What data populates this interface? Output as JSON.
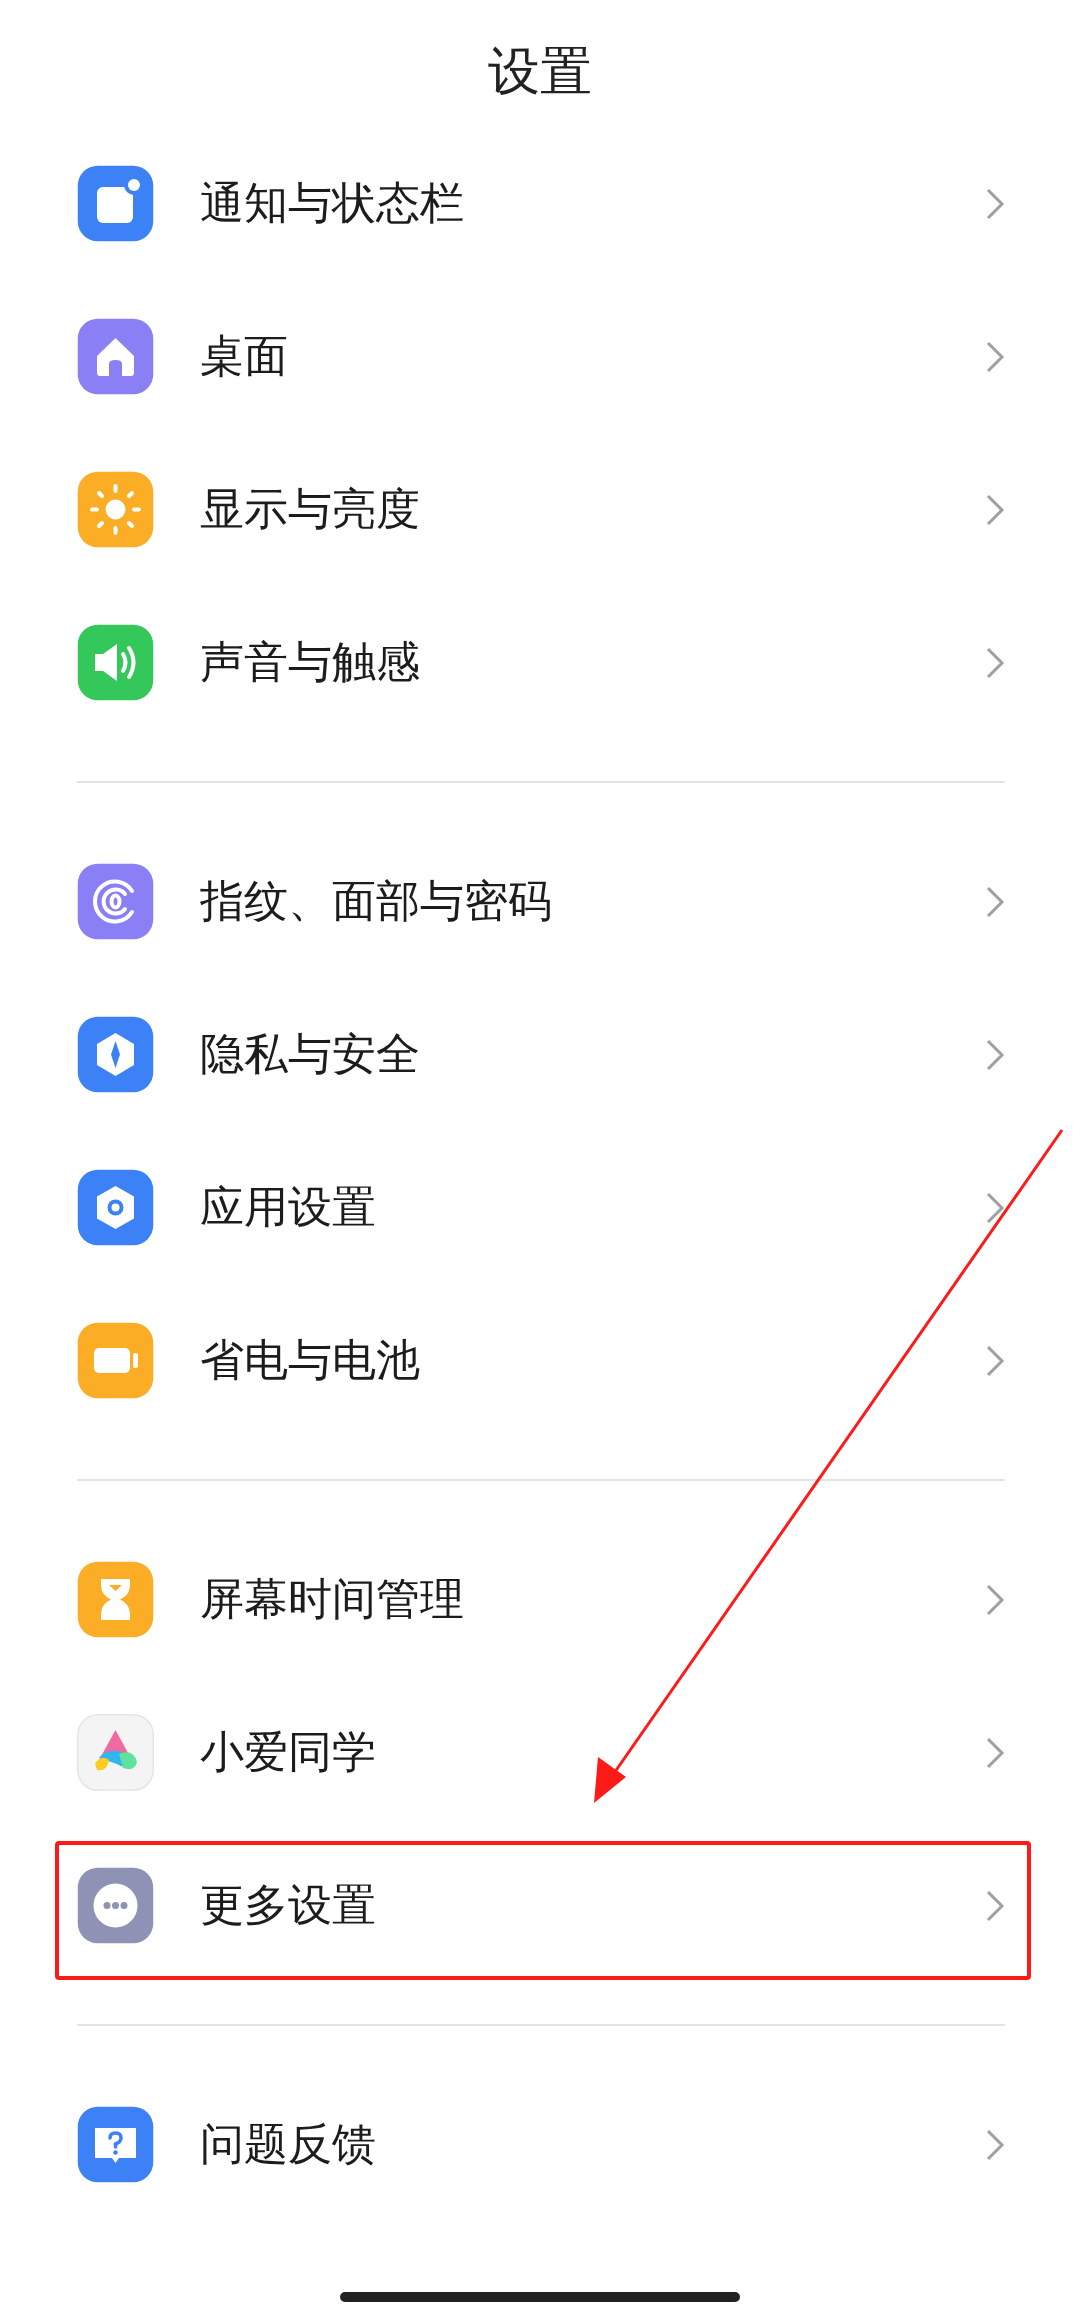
{
  "title": "设置",
  "groups": [
    {
      "items": [
        {
          "label": "通知与状态栏",
          "highlighted": false
        },
        {
          "label": "桌面",
          "highlighted": false
        },
        {
          "label": "显示与亮度",
          "highlighted": false
        },
        {
          "label": "声音与触感",
          "highlighted": false
        }
      ]
    },
    {
      "items": [
        {
          "label": "指纹、面部与密码",
          "highlighted": false
        },
        {
          "label": "隐私与安全",
          "highlighted": false
        },
        {
          "label": "应用设置",
          "highlighted": false
        },
        {
          "label": "省电与电池",
          "highlighted": false
        }
      ]
    },
    {
      "items": [
        {
          "label": "屏幕时间管理",
          "highlighted": false
        },
        {
          "label": "小爱同学",
          "highlighted": false
        },
        {
          "label": "更多设置",
          "highlighted": true
        }
      ]
    },
    {
      "items": [
        {
          "label": "问题反馈",
          "highlighted": false
        }
      ]
    }
  ]
}
